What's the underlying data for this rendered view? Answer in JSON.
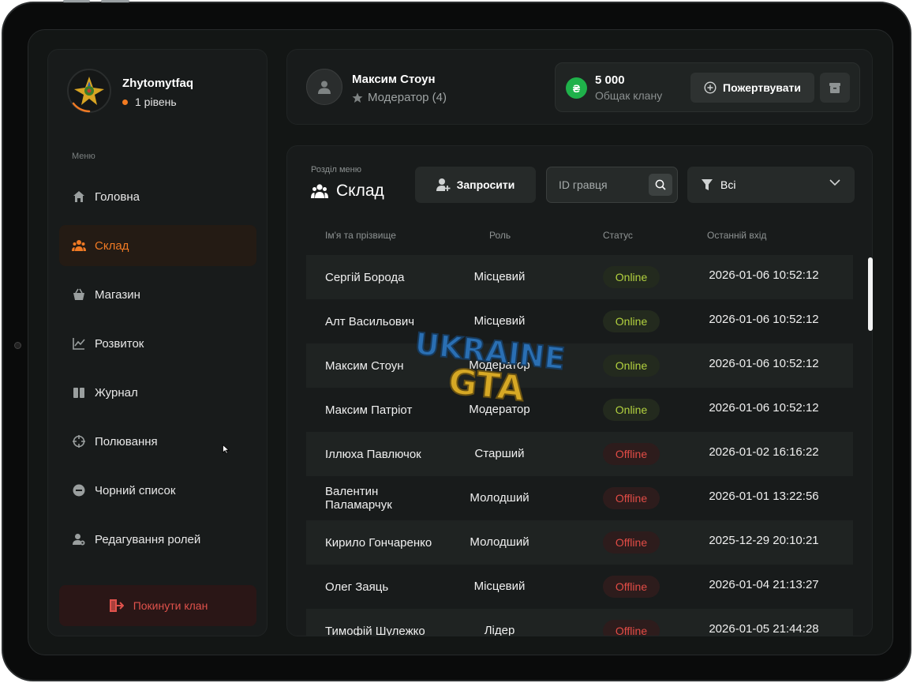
{
  "clan": {
    "name": "Zhytomytfaq",
    "level": "1 рівень"
  },
  "menu": {
    "title": "Меню",
    "items": [
      {
        "label": "Головна",
        "icon": "home-icon"
      },
      {
        "label": "Склад",
        "icon": "users-icon",
        "active": true
      },
      {
        "label": "Магазин",
        "icon": "basket-icon"
      },
      {
        "label": "Розвиток",
        "icon": "chart-icon"
      },
      {
        "label": "Журнал",
        "icon": "book-icon"
      },
      {
        "label": "Полювання",
        "icon": "crosshair-icon"
      },
      {
        "label": "Чорний список",
        "icon": "minus-circle-icon"
      },
      {
        "label": "Редагування ролей",
        "icon": "user-settings-icon"
      }
    ],
    "leave_label": "Покинути клан"
  },
  "profile": {
    "name": "Максим Стоун",
    "role": "Модератор (4)"
  },
  "treasury": {
    "currency_symbol": "₴",
    "amount": "5 000",
    "label": "Общак клану",
    "donate_label": "Пожертвувати"
  },
  "section": {
    "label": "Розділ меню",
    "title": "Склад"
  },
  "toolbar": {
    "invite_label": "Запросити",
    "search_placeholder": "ID гравця",
    "filter_value": "Всі"
  },
  "table": {
    "columns": [
      "Ім'я та прізвище",
      "Роль",
      "Статус",
      "Останній вхід"
    ],
    "rows": [
      {
        "name": "Сергій Борода",
        "role": "Місцевий",
        "status": "Online",
        "last_login": "2026-01-06 10:52:12"
      },
      {
        "name": "Алт Васильович",
        "role": "Місцевий",
        "status": "Online",
        "last_login": "2026-01-06 10:52:12"
      },
      {
        "name": "Максим Стоун",
        "role": "Модератор",
        "status": "Online",
        "last_login": "2026-01-06 10:52:12"
      },
      {
        "name": "Максим Патріот",
        "role": "Модератор",
        "status": "Online",
        "last_login": "2026-01-06 10:52:12"
      },
      {
        "name": "Іллюха Павлючок",
        "role": "Старший",
        "status": "Offline",
        "last_login": "2026-01-02 16:16:22"
      },
      {
        "name": "Валентин Паламарчук",
        "role": "Молодший",
        "status": "Offline",
        "last_login": "2026-01-01 13:22:56"
      },
      {
        "name": "Кирило Гончаренко",
        "role": "Молодший",
        "status": "Offline",
        "last_login": "2025-12-29 20:10:21"
      },
      {
        "name": "Олег Заяць",
        "role": "Місцевий",
        "status": "Offline",
        "last_login": "2026-01-04 21:13:27"
      },
      {
        "name": "Тимофій Шулежко",
        "role": "Лідер",
        "status": "Offline",
        "last_login": "2026-01-05 21:44:28"
      }
    ]
  },
  "watermark": {
    "line1": "UKRAINE",
    "line2": "GTA"
  },
  "colors": {
    "accent": "#f07a24",
    "online": "#b3d23f",
    "offline": "#e24c46",
    "coin": "#1fb14a",
    "danger": "#e0524c"
  }
}
